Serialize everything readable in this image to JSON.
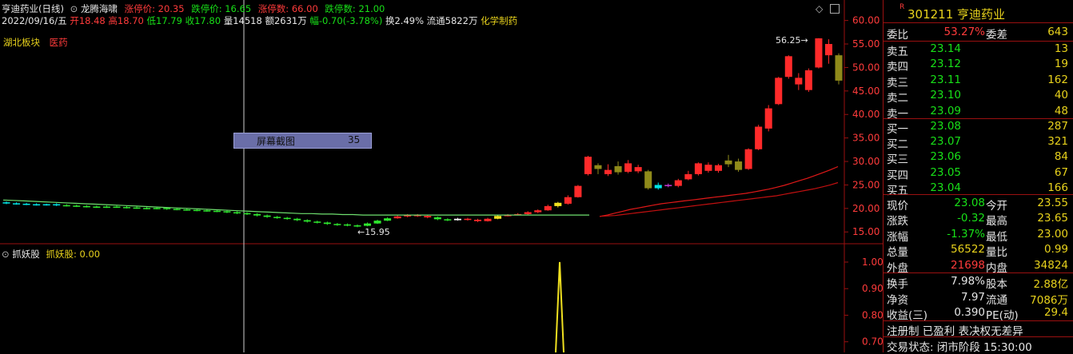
{
  "header": {
    "title": "亨迪药业(日线)",
    "indicator_name": "龙腾海啸",
    "limit_up_price": "涨停价: 20.35",
    "limit_down_price": "跌停价: 16.65",
    "limit_up_count": "涨停数: 66.00",
    "limit_down_count": "跌停数: 21.00",
    "date": "2022/09/16/五",
    "open": "开18.48",
    "high": "高18.70",
    "low": "低17.79",
    "close": "收17.80",
    "volume": "量14518",
    "amount": "额2631万",
    "change": "幅-0.70(-3.78%)",
    "turnover": "换2.49%",
    "float": "流通5822万",
    "industry": "化学制药",
    "region_tag": "湖北板块",
    "sector_tag": "医药"
  },
  "tooltip": {
    "label": "屏幕截图",
    "value": "35"
  },
  "annotations": {
    "high": "56.25",
    "low": "15.95"
  },
  "lower_panel": {
    "name": "抓妖股",
    "value_text": "抓妖股: 0.00"
  },
  "colors": {
    "up": "#ff2a2a",
    "down": "#00e5e5",
    "flat": "#ffffff",
    "green_candle": "#2ee82e",
    "olive": "#8f8a1a",
    "ma_red": "#e01818",
    "ma_green": "#6fe06f",
    "yellow": "#f0e020"
  },
  "chart_data": [
    {
      "type": "candlestick",
      "ylim": [
        13,
        63
      ],
      "yticks": [
        "60.00",
        "55.00",
        "50.00",
        "45.00",
        "40.00",
        "35.00",
        "30.00",
        "25.00",
        "20.00",
        "15.00"
      ],
      "candles": [
        {
          "o": 21.3,
          "c": 21.1,
          "h": 21.5,
          "l": 20.9,
          "k": "c"
        },
        {
          "o": 21.1,
          "c": 21.0,
          "h": 21.3,
          "l": 20.8,
          "k": "c"
        },
        {
          "o": 21.0,
          "c": 20.9,
          "h": 21.2,
          "l": 20.7,
          "k": "c"
        },
        {
          "o": 20.9,
          "c": 20.8,
          "h": 21.1,
          "l": 20.6,
          "k": "c"
        },
        {
          "o": 20.8,
          "c": 20.9,
          "h": 21.0,
          "l": 20.6,
          "k": "c"
        },
        {
          "o": 20.9,
          "c": 20.7,
          "h": 21.1,
          "l": 20.5,
          "k": "c"
        },
        {
          "o": 20.7,
          "c": 20.6,
          "h": 20.9,
          "l": 20.4,
          "k": "g"
        },
        {
          "o": 20.6,
          "c": 20.5,
          "h": 20.8,
          "l": 20.3,
          "k": "g"
        },
        {
          "o": 20.5,
          "c": 20.4,
          "h": 20.7,
          "l": 20.2,
          "k": "g"
        },
        {
          "o": 20.4,
          "c": 20.3,
          "h": 20.6,
          "l": 20.1,
          "k": "g"
        },
        {
          "o": 20.3,
          "c": 20.4,
          "h": 20.6,
          "l": 20.1,
          "k": "g"
        },
        {
          "o": 20.4,
          "c": 20.3,
          "h": 20.6,
          "l": 20.1,
          "k": "g"
        },
        {
          "o": 20.3,
          "c": 20.2,
          "h": 20.5,
          "l": 20.0,
          "k": "g"
        },
        {
          "o": 20.2,
          "c": 20.1,
          "h": 20.4,
          "l": 19.9,
          "k": "g"
        },
        {
          "o": 20.1,
          "c": 20.0,
          "h": 20.3,
          "l": 19.8,
          "k": "g"
        },
        {
          "o": 20.0,
          "c": 20.1,
          "h": 20.3,
          "l": 19.8,
          "k": "g"
        },
        {
          "o": 20.1,
          "c": 19.9,
          "h": 20.2,
          "l": 19.7,
          "k": "g"
        },
        {
          "o": 19.9,
          "c": 19.8,
          "h": 20.1,
          "l": 19.6,
          "k": "g"
        },
        {
          "o": 19.8,
          "c": 19.7,
          "h": 20.0,
          "l": 19.5,
          "k": "g"
        },
        {
          "o": 19.7,
          "c": 19.6,
          "h": 19.9,
          "l": 19.4,
          "k": "g"
        },
        {
          "o": 19.6,
          "c": 19.5,
          "h": 19.8,
          "l": 19.3,
          "k": "g"
        },
        {
          "o": 19.5,
          "c": 19.4,
          "h": 19.7,
          "l": 19.2,
          "k": "g"
        },
        {
          "o": 19.4,
          "c": 19.2,
          "h": 19.6,
          "l": 19.0,
          "k": "g"
        },
        {
          "o": 19.2,
          "c": 19.0,
          "h": 19.4,
          "l": 18.8,
          "k": "g"
        },
        {
          "o": 19.0,
          "c": 18.8,
          "h": 19.2,
          "l": 18.6,
          "k": "g"
        },
        {
          "o": 18.8,
          "c": 18.5,
          "h": 19.0,
          "l": 18.3,
          "k": "g"
        },
        {
          "o": 18.5,
          "c": 18.2,
          "h": 18.7,
          "l": 18.0,
          "k": "g"
        },
        {
          "o": 18.2,
          "c": 18.0,
          "h": 18.4,
          "l": 17.8,
          "k": "g"
        },
        {
          "o": 18.0,
          "c": 17.8,
          "h": 18.2,
          "l": 17.6,
          "k": "g"
        },
        {
          "o": 17.8,
          "c": 17.5,
          "h": 18.0,
          "l": 17.3,
          "k": "g"
        },
        {
          "o": 17.5,
          "c": 17.2,
          "h": 17.7,
          "l": 17.0,
          "k": "g"
        },
        {
          "o": 17.2,
          "c": 17.0,
          "h": 17.4,
          "l": 16.8,
          "k": "g"
        },
        {
          "o": 17.0,
          "c": 16.7,
          "h": 17.2,
          "l": 16.5,
          "k": "g"
        },
        {
          "o": 16.7,
          "c": 16.6,
          "h": 16.9,
          "l": 16.3,
          "k": "g"
        },
        {
          "o": 16.6,
          "c": 16.4,
          "h": 16.8,
          "l": 16.2,
          "k": "g"
        },
        {
          "o": 16.4,
          "c": 16.3,
          "h": 16.6,
          "l": 16.0,
          "k": "g"
        },
        {
          "o": 16.3,
          "c": 16.8,
          "h": 17.0,
          "l": 16.2,
          "k": "g"
        },
        {
          "o": 16.8,
          "c": 17.4,
          "h": 17.6,
          "l": 16.7,
          "k": "g"
        },
        {
          "o": 17.4,
          "c": 17.9,
          "h": 18.1,
          "l": 17.3,
          "k": "g"
        },
        {
          "o": 17.9,
          "c": 18.3,
          "h": 18.5,
          "l": 17.8,
          "k": "r"
        },
        {
          "o": 18.3,
          "c": 18.6,
          "h": 18.8,
          "l": 18.1,
          "k": "r"
        },
        {
          "o": 18.6,
          "c": 18.4,
          "h": 18.8,
          "l": 18.2,
          "k": "r"
        },
        {
          "o": 18.4,
          "c": 18.1,
          "h": 18.6,
          "l": 17.9,
          "k": "r"
        },
        {
          "o": 18.1,
          "c": 17.7,
          "h": 18.3,
          "l": 17.5,
          "k": "g"
        },
        {
          "o": 17.7,
          "c": 17.5,
          "h": 17.9,
          "l": 17.3,
          "k": "g"
        },
        {
          "o": 17.5,
          "c": 17.8,
          "h": 18.0,
          "l": 17.4,
          "k": "w"
        },
        {
          "o": 17.8,
          "c": 17.6,
          "h": 18.0,
          "l": 17.4,
          "k": "r"
        },
        {
          "o": 17.6,
          "c": 17.3,
          "h": 17.8,
          "l": 17.1,
          "k": "r"
        },
        {
          "o": 17.3,
          "c": 17.8,
          "h": 18.0,
          "l": 17.2,
          "k": "r"
        },
        {
          "o": 17.8,
          "c": 18.4,
          "h": 18.6,
          "l": 17.7,
          "k": "y"
        },
        {
          "o": 18.4,
          "c": 18.6,
          "h": 18.8,
          "l": 18.3,
          "k": "r"
        },
        {
          "o": 18.6,
          "c": 18.8,
          "h": 19.0,
          "l": 18.5,
          "k": "r"
        },
        {
          "o": 18.8,
          "c": 19.2,
          "h": 19.4,
          "l": 18.7,
          "k": "r"
        },
        {
          "o": 19.2,
          "c": 19.6,
          "h": 19.8,
          "l": 19.0,
          "k": "r"
        },
        {
          "o": 19.6,
          "c": 20.5,
          "h": 20.8,
          "l": 19.5,
          "k": "r"
        },
        {
          "o": 20.5,
          "c": 21.2,
          "h": 21.4,
          "l": 20.2,
          "k": "y"
        },
        {
          "o": 21.0,
          "c": 22.4,
          "h": 22.8,
          "l": 20.8,
          "k": "r"
        },
        {
          "o": 22.4,
          "c": 24.8,
          "h": 25.0,
          "l": 22.3,
          "k": "r"
        },
        {
          "o": 27.3,
          "c": 31.0,
          "h": 31.2,
          "l": 27.0,
          "k": "r"
        },
        {
          "o": 28.4,
          "c": 29.2,
          "h": 29.6,
          "l": 27.3,
          "k": "o"
        },
        {
          "o": 28.2,
          "c": 27.3,
          "h": 29.4,
          "l": 26.9,
          "k": "r"
        },
        {
          "o": 27.7,
          "c": 29.0,
          "h": 30.0,
          "l": 27.2,
          "k": "o"
        },
        {
          "o": 29.6,
          "c": 27.8,
          "h": 30.3,
          "l": 27.5,
          "k": "r"
        },
        {
          "o": 28.8,
          "c": 27.9,
          "h": 29.3,
          "l": 27.5,
          "k": "r"
        },
        {
          "o": 27.9,
          "c": 24.3,
          "h": 28.2,
          "l": 24.0,
          "k": "o"
        },
        {
          "o": 24.3,
          "c": 25.0,
          "h": 25.5,
          "l": 24.0,
          "k": "c"
        },
        {
          "o": 25.0,
          "c": 24.8,
          "h": 25.3,
          "l": 24.5,
          "k": "m"
        },
        {
          "o": 24.8,
          "c": 26.0,
          "h": 26.3,
          "l": 24.5,
          "k": "r"
        },
        {
          "o": 26.2,
          "c": 27.3,
          "h": 28.0,
          "l": 26.0,
          "k": "r"
        },
        {
          "o": 27.3,
          "c": 29.6,
          "h": 29.8,
          "l": 27.0,
          "k": "r"
        },
        {
          "o": 29.3,
          "c": 28.0,
          "h": 29.8,
          "l": 27.6,
          "k": "r"
        },
        {
          "o": 28.0,
          "c": 29.2,
          "h": 29.5,
          "l": 27.6,
          "k": "r"
        },
        {
          "o": 29.4,
          "c": 30.2,
          "h": 31.4,
          "l": 28.8,
          "k": "o"
        },
        {
          "o": 30.0,
          "c": 28.2,
          "h": 30.6,
          "l": 27.8,
          "k": "o"
        },
        {
          "o": 28.4,
          "c": 32.6,
          "h": 32.8,
          "l": 28.2,
          "k": "r"
        },
        {
          "o": 32.6,
          "c": 37.4,
          "h": 37.8,
          "l": 32.4,
          "k": "r"
        },
        {
          "o": 37.0,
          "c": 41.3,
          "h": 42.0,
          "l": 36.4,
          "k": "r"
        },
        {
          "o": 42.2,
          "c": 47.8,
          "h": 48.0,
          "l": 42.0,
          "k": "r"
        },
        {
          "o": 48.0,
          "c": 52.4,
          "h": 52.6,
          "l": 47.6,
          "k": "r"
        },
        {
          "o": 47.8,
          "c": 46.4,
          "h": 48.8,
          "l": 45.2,
          "k": "r"
        },
        {
          "o": 49.4,
          "c": 45.2,
          "h": 49.8,
          "l": 44.8,
          "k": "r"
        },
        {
          "o": 50.0,
          "c": 56.2,
          "h": 56.25,
          "l": 49.8,
          "k": "r"
        },
        {
          "o": 55.0,
          "c": 52.6,
          "h": 56.0,
          "l": 50.8,
          "k": "r"
        },
        {
          "o": 52.6,
          "c": 47.2,
          "h": 53.0,
          "l": 46.4,
          "k": "o"
        }
      ],
      "ma_green": [
        21.8,
        21.7,
        21.6,
        21.5,
        21.4,
        21.3,
        21.2,
        21.1,
        21.0,
        20.9,
        20.8,
        20.7,
        20.6,
        20.5,
        20.4,
        20.3,
        20.2,
        20.1,
        20.0,
        19.9,
        19.8,
        19.7,
        19.6,
        19.5,
        19.4,
        19.3,
        19.2,
        19.1,
        19.0,
        18.9,
        18.9,
        18.8,
        18.8,
        18.7,
        18.7,
        18.6,
        18.6,
        18.6,
        18.6,
        18.6,
        18.6,
        18.6,
        18.6,
        18.6,
        18.6,
        18.6,
        18.6,
        18.6,
        18.6,
        18.6,
        18.6,
        18.6,
        18.6,
        18.6,
        18.6,
        18.6,
        18.6,
        18.6
      ],
      "ma_red1": [
        18.3,
        18.6,
        19.0,
        19.4,
        19.8,
        20.1,
        20.4,
        20.7,
        21.0,
        21.2,
        21.4,
        21.6,
        21.8,
        22.0,
        22.2,
        22.4,
        22.6,
        22.8,
        23.0,
        23.2,
        23.5,
        23.8,
        24.1,
        24.5,
        24.9,
        25.4,
        25.9,
        26.4,
        27.0,
        27.6,
        28.2,
        28.9
      ],
      "ma_red2": [
        18.3,
        18.4,
        18.5,
        18.7,
        18.9,
        19.1,
        19.3,
        19.5,
        19.7,
        19.9,
        20.1,
        20.3,
        20.5,
        20.7,
        20.9,
        21.1,
        21.3,
        21.5,
        21.7,
        21.9,
        22.1,
        22.3,
        22.5,
        22.7,
        23.0,
        23.3,
        23.6,
        23.9,
        24.2,
        24.6,
        25.0,
        25.5
      ]
    },
    {
      "type": "line",
      "name": "抓妖股",
      "ylim": [
        0.66,
        1.03
      ],
      "yticks": [
        "1.00",
        "0.90",
        "0.80",
        "0.70"
      ],
      "spike_value": 1.0
    }
  ],
  "quote": {
    "symbol_badge": "R",
    "code": "301211",
    "name": "亨迪药业",
    "ratio_label": "委比",
    "ratio_value": "53.27%",
    "diff_label": "委差",
    "diff_value": "643",
    "asks": [
      {
        "label": "卖五",
        "price": "23.14",
        "vol": "13"
      },
      {
        "label": "卖四",
        "price": "23.12",
        "vol": "19"
      },
      {
        "label": "卖三",
        "price": "23.11",
        "vol": "162"
      },
      {
        "label": "卖二",
        "price": "23.10",
        "vol": "40"
      },
      {
        "label": "卖一",
        "price": "23.09",
        "vol": "48"
      }
    ],
    "bids": [
      {
        "label": "买一",
        "price": "23.08",
        "vol": "287"
      },
      {
        "label": "买二",
        "price": "23.07",
        "vol": "321"
      },
      {
        "label": "买三",
        "price": "23.06",
        "vol": "84"
      },
      {
        "label": "买四",
        "price": "23.05",
        "vol": "67"
      },
      {
        "label": "买五",
        "price": "23.04",
        "vol": "166"
      }
    ],
    "stats": [
      {
        "l1": "现价",
        "v1": "23.08",
        "c1": "grn",
        "l2": "今开",
        "v2": "23.55",
        "c2": "red"
      },
      {
        "l1": "涨跌",
        "v1": "-0.32",
        "c1": "grn",
        "l2": "最高",
        "v2": "23.65",
        "c2": "red"
      },
      {
        "l1": "涨幅",
        "v1": "-1.37%",
        "c1": "grn",
        "l2": "最低",
        "v2": "23.00",
        "c2": "grn"
      },
      {
        "l1": "总量",
        "v1": "56522",
        "c1": "yel",
        "l2": "量比",
        "v2": "0.99",
        "c2": "grn"
      },
      {
        "l1": "外盘",
        "v1": "21698",
        "c1": "red",
        "l2": "内盘",
        "v2": "34824",
        "c2": "grn"
      }
    ],
    "fund": [
      {
        "l1": "换手",
        "v1": "7.98%",
        "l2": "股本",
        "v2": "2.88亿"
      },
      {
        "l1": "净资",
        "v1": "7.97",
        "l2": "流通",
        "v2": "7086万"
      },
      {
        "l1": "收益(三)",
        "v1": "0.390",
        "l2": "PE(动)",
        "v2": "29.4"
      }
    ],
    "note": "注册制 已盈利 表决权无差异",
    "status": "交易状态: 闭市阶段 15:30:00"
  }
}
